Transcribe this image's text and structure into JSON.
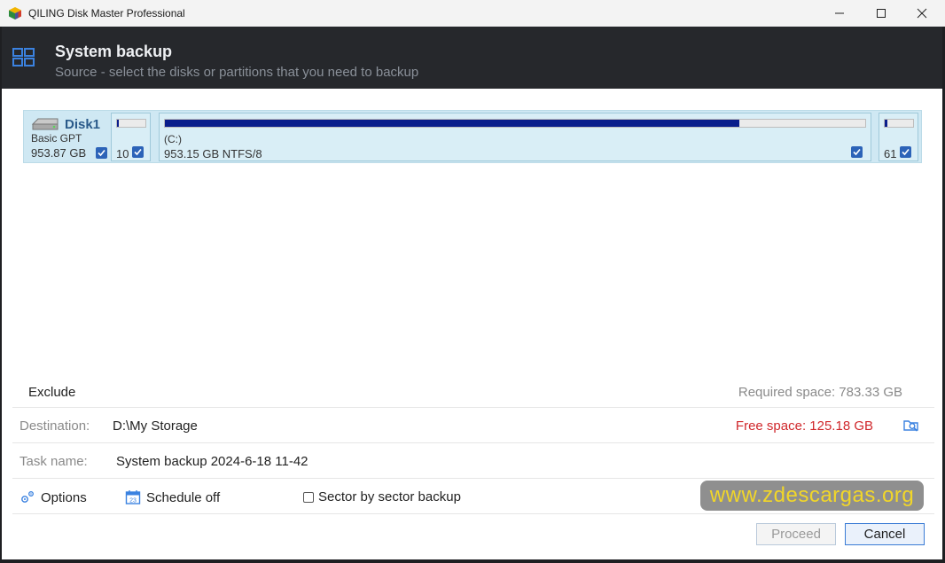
{
  "window": {
    "title": "QILING Disk Master Professional",
    "controls": [
      "minimize",
      "maximize",
      "close"
    ]
  },
  "header": {
    "icon": "layout-grid-icon",
    "title": "System backup",
    "subtitle": "Source - select the disks or partitions that you need to backup"
  },
  "disk": {
    "name": "Disk1",
    "type": "Basic GPT",
    "size": "953.87 GB",
    "checked": true,
    "partitions": [
      {
        "label": "",
        "size": "10",
        "usage": 0.05,
        "checked": true
      },
      {
        "label": "(C:)",
        "size": "953.15 GB NTFS/8",
        "usage": 0.82,
        "checked": true
      },
      {
        "label": "",
        "size": "61",
        "usage": 0.1,
        "checked": true
      }
    ]
  },
  "exclude": {
    "label": "Exclude"
  },
  "required_space": "Required space: 783.33 GB",
  "destination": {
    "label": "Destination:",
    "value": "D:\\My Storage",
    "free_space": "Free space: 125.18 GB"
  },
  "task": {
    "label": "Task name:",
    "value": "System backup 2024-6-18 11-42"
  },
  "options": {
    "options_label": "Options",
    "schedule_label": "Schedule off",
    "schedule_day": "23",
    "sector_label": "Sector by sector backup",
    "sector_checked": false
  },
  "watermark": "www.zdescargas.org",
  "buttons": {
    "proceed": "Proceed",
    "cancel": "Cancel"
  },
  "colors": {
    "header_bg": "#26282c",
    "accent": "#2c63b8",
    "free_space": "#d0282c",
    "partition_fill": "#0a1e8c"
  }
}
